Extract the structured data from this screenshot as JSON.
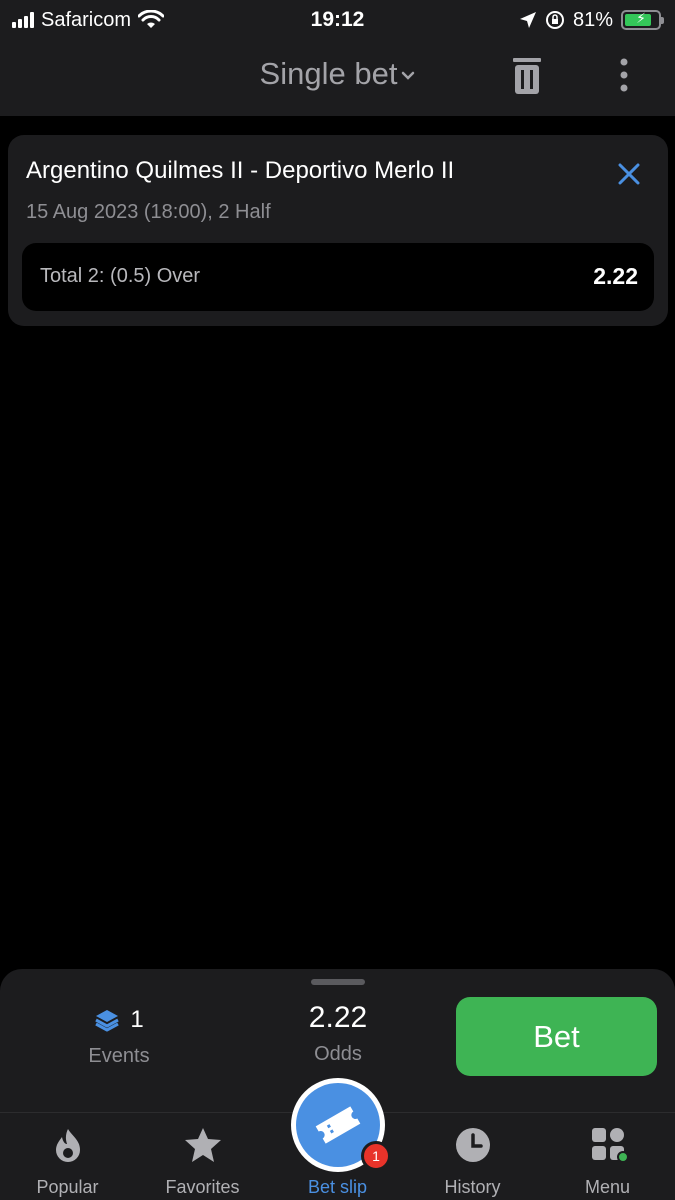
{
  "status_bar": {
    "carrier": "Safaricom",
    "time": "19:12",
    "battery_percent": "81%",
    "battery_level": 0.81,
    "signal_bars": 4
  },
  "header": {
    "title": "Single bet",
    "icons": [
      "chevron-down-icon",
      "trash-icon",
      "more-vertical-icon"
    ]
  },
  "bet_card": {
    "match": "Argentino Quilmes II - Deportivo Merlo II",
    "meta": "15 Aug 2023 (18:00), 2 Half",
    "outcome": "Total 2: (0.5) Over",
    "odds": "2.22"
  },
  "summary": {
    "events_count": "1",
    "events_label": "Events",
    "odds_value": "2.22",
    "odds_label": "Odds",
    "bet_label": "Bet"
  },
  "tabs": [
    {
      "label": "Popular",
      "icon": "flame-icon"
    },
    {
      "label": "Favorites",
      "icon": "star-icon"
    },
    {
      "label": "Bet slip",
      "icon": "ticket-icon",
      "badge": "1"
    },
    {
      "label": "History",
      "icon": "clock-icon"
    },
    {
      "label": "Menu",
      "icon": "grid-icon"
    }
  ],
  "colors": {
    "accent": "#4a90e2",
    "bet_button": "#3eb454",
    "badge": "#e8332a",
    "surface": "#1c1c1e"
  }
}
